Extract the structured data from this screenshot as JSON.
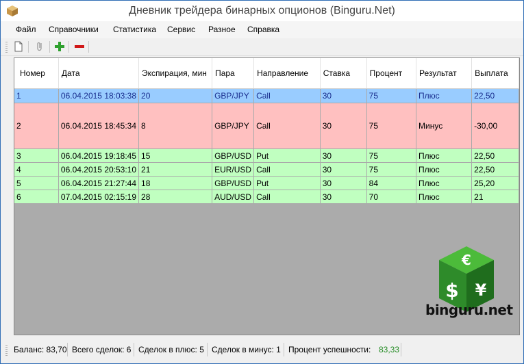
{
  "window": {
    "title": "Дневник трейдера бинарных опционов (Binguru.Net)"
  },
  "menu": [
    "Файл",
    "Справочники",
    "Статистика",
    "Сервис",
    "Разное",
    "Справка"
  ],
  "toolbar": {
    "icons": [
      "new-document-icon",
      "attach-icon",
      "add-icon",
      "remove-icon"
    ]
  },
  "table": {
    "columns": [
      "Номер",
      "Дата",
      "Экспирация, мин",
      "Пара",
      "Направление",
      "Ставка",
      "Процент",
      "Результат",
      "Выплата"
    ],
    "rows": [
      [
        "1",
        "06.04.2015 18:03:38",
        "20",
        "GBP/JPY",
        "Call",
        "30",
        "75",
        "Плюс",
        "22,50"
      ],
      [
        "2",
        "06.04.2015 18:45:34",
        "8",
        "GBP/JPY",
        "Call",
        "30",
        "75",
        "Минус",
        "-30,00"
      ],
      [
        "3",
        "06.04.2015 19:18:45",
        "15",
        "GBP/USD",
        "Put",
        "30",
        "75",
        "Плюс",
        "22,50"
      ],
      [
        "4",
        "06.04.2015 20:53:10",
        "21",
        "EUR/USD",
        "Call",
        "30",
        "75",
        "Плюс",
        "22,50"
      ],
      [
        "5",
        "06.04.2015 21:27:44",
        "18",
        "GBP/USD",
        "Put",
        "30",
        "84",
        "Плюс",
        "25,20"
      ],
      [
        "6",
        "07.04.2015 02:15:19",
        "28",
        "AUD/USD",
        "Call",
        "30",
        "70",
        "Плюс",
        "21"
      ]
    ]
  },
  "logo": {
    "text": "binguru.net",
    "symbols": [
      "€",
      "$",
      "¥"
    ]
  },
  "status": {
    "balance": "Баланс: 83,70",
    "total": "Всего сделок: 6",
    "plus": "Сделок в плюс: 5",
    "minus": "Сделок в минус: 1",
    "rate_label": "Процент успешности:",
    "rate_value": "83,33"
  },
  "colors": {
    "selected": "#99ccff",
    "loss": "#ffc0c0",
    "win": "#c0ffc0",
    "green_text": "#228b22"
  }
}
